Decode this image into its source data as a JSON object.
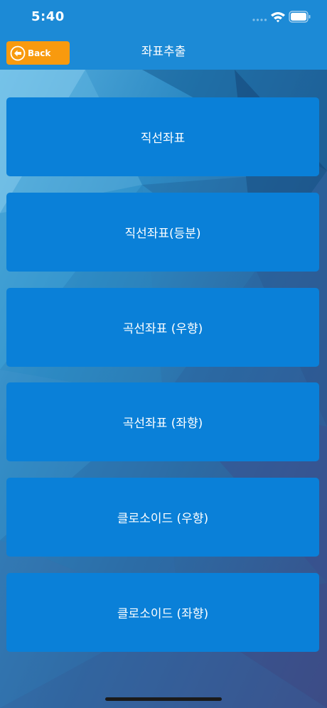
{
  "status_bar": {
    "time": "5:40"
  },
  "nav": {
    "back_label": "Back",
    "title": "좌표추출"
  },
  "menu": {
    "items": [
      {
        "label": "직선좌표"
      },
      {
        "label": "직선좌표(등분)"
      },
      {
        "label": "곡선좌표 (우향)"
      },
      {
        "label": "곡선좌표 (좌향)"
      },
      {
        "label": "클로소이드 (우향)"
      },
      {
        "label": "클로소이드 (좌향)"
      }
    ]
  },
  "colors": {
    "bar_blue": "#1c8ad6",
    "button_blue": "#0a80d8",
    "back_orange": "#f89a0e",
    "text": "#ffffff"
  },
  "icons": {
    "back": "back-arrow-circle-icon",
    "signal": "cellular-signal-icon",
    "wifi": "wifi-icon",
    "battery": "battery-icon"
  }
}
